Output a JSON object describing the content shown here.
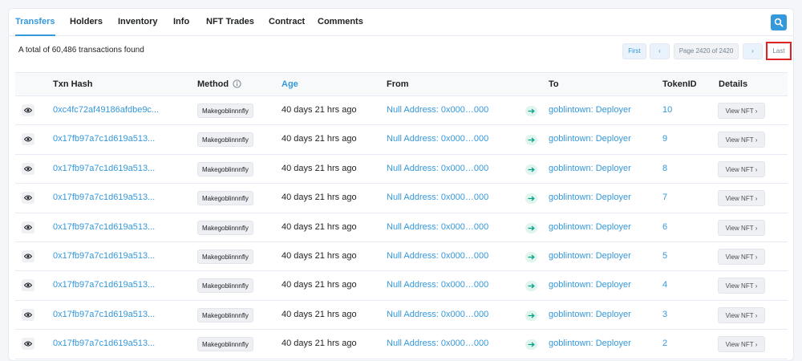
{
  "tabs": [
    "Transfers",
    "Holders",
    "Inventory",
    "Info",
    "NFT Trades",
    "Contract",
    "Comments"
  ],
  "summary": "A total of 60,486 transactions found",
  "pagination": {
    "first": "First",
    "prev": "‹",
    "page_info": "Page 2420 of 2420",
    "next": "›",
    "last": "Last"
  },
  "columns": {
    "txn_hash": "Txn Hash",
    "method": "Method",
    "age": "Age",
    "from": "From",
    "to": "To",
    "token_id": "TokenID",
    "details": "Details"
  },
  "rows": [
    {
      "hash": "0xc4fc72af49186afdbe9c...",
      "method": "Makegoblinnnfly",
      "age": "40 days 21 hrs ago",
      "from": "Null Address: 0x000…000",
      "to": "goblintown: Deployer",
      "token_id": "10",
      "details": "View NFT ›"
    },
    {
      "hash": "0x17fb97a7c1d619a513...",
      "method": "Makegoblinnnfly",
      "age": "40 days 21 hrs ago",
      "from": "Null Address: 0x000…000",
      "to": "goblintown: Deployer",
      "token_id": "9",
      "details": "View NFT ›"
    },
    {
      "hash": "0x17fb97a7c1d619a513...",
      "method": "Makegoblinnnfly",
      "age": "40 days 21 hrs ago",
      "from": "Null Address: 0x000…000",
      "to": "goblintown: Deployer",
      "token_id": "8",
      "details": "View NFT ›"
    },
    {
      "hash": "0x17fb97a7c1d619a513...",
      "method": "Makegoblinnnfly",
      "age": "40 days 21 hrs ago",
      "from": "Null Address: 0x000…000",
      "to": "goblintown: Deployer",
      "token_id": "7",
      "details": "View NFT ›"
    },
    {
      "hash": "0x17fb97a7c1d619a513...",
      "method": "Makegoblinnnfly",
      "age": "40 days 21 hrs ago",
      "from": "Null Address: 0x000…000",
      "to": "goblintown: Deployer",
      "token_id": "6",
      "details": "View NFT ›"
    },
    {
      "hash": "0x17fb97a7c1d619a513...",
      "method": "Makegoblinnnfly",
      "age": "40 days 21 hrs ago",
      "from": "Null Address: 0x000…000",
      "to": "goblintown: Deployer",
      "token_id": "5",
      "details": "View NFT ›"
    },
    {
      "hash": "0x17fb97a7c1d619a513...",
      "method": "Makegoblinnnfly",
      "age": "40 days 21 hrs ago",
      "from": "Null Address: 0x000…000",
      "to": "goblintown: Deployer",
      "token_id": "4",
      "details": "View NFT ›"
    },
    {
      "hash": "0x17fb97a7c1d619a513...",
      "method": "Makegoblinnnfly",
      "age": "40 days 21 hrs ago",
      "from": "Null Address: 0x000…000",
      "to": "goblintown: Deployer",
      "token_id": "3",
      "details": "View NFT ›"
    },
    {
      "hash": "0x17fb97a7c1d619a513...",
      "method": "Makegoblinnnfly",
      "age": "40 days 21 hrs ago",
      "from": "Null Address: 0x000…000",
      "to": "goblintown: Deployer",
      "token_id": "2",
      "details": "View NFT ›"
    }
  ],
  "icons": {
    "search": "search-icon",
    "info": "info-icon",
    "eye": "eye-icon",
    "arrow": "arrow-right-icon"
  },
  "colors": {
    "accent": "#3498db",
    "highlight": "#e02424",
    "arrow_badge": "#00a186"
  }
}
